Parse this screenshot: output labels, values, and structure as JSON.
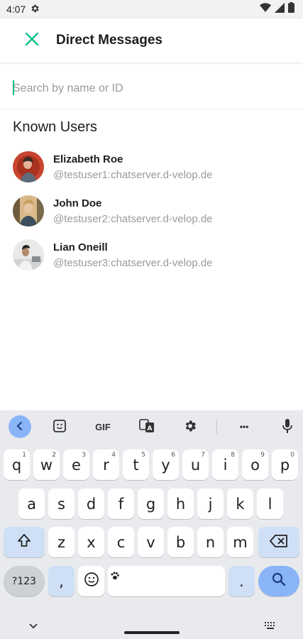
{
  "status_bar": {
    "time": "4:07",
    "icons": [
      "settings-gear-icon",
      "wifi-icon",
      "signal-icon",
      "battery-icon"
    ]
  },
  "app_bar": {
    "title": "Direct Messages",
    "close_icon": "close-icon",
    "accent_color": "#0dbd8b"
  },
  "search": {
    "placeholder": "Search by name or ID",
    "value": ""
  },
  "known_users": {
    "title": "Known Users",
    "users": [
      {
        "name": "Elizabeth Roe",
        "id": "@testuser1:chatserver.d-velop.de"
      },
      {
        "name": "John Doe",
        "id": "@testuser2:chatserver.d-velop.de"
      },
      {
        "name": "Lian Oneill",
        "id": "@testuser3:chatserver.d-velop.de"
      }
    ]
  },
  "keyboard": {
    "toolbar": {
      "back_icon": "chevron-left-icon",
      "sticker_icon": "sticker-icon",
      "gif_label": "GIF",
      "translate_icon": "translate-icon",
      "settings_icon": "gear-icon",
      "more_label": "•••",
      "mic_icon": "microphone-icon"
    },
    "row1": [
      {
        "key": "q",
        "num": "1"
      },
      {
        "key": "w",
        "num": "2"
      },
      {
        "key": "e",
        "num": "3"
      },
      {
        "key": "r",
        "num": "4"
      },
      {
        "key": "t",
        "num": "5"
      },
      {
        "key": "y",
        "num": "6"
      },
      {
        "key": "u",
        "num": "7"
      },
      {
        "key": "i",
        "num": "8"
      },
      {
        "key": "o",
        "num": "9"
      },
      {
        "key": "p",
        "num": "0"
      }
    ],
    "row2": [
      "a",
      "s",
      "d",
      "f",
      "g",
      "h",
      "j",
      "k",
      "l"
    ],
    "row3": [
      "z",
      "x",
      "c",
      "v",
      "b",
      "n",
      "m"
    ],
    "symbols_label": "?123",
    "comma_label": ",",
    "period_label": ".",
    "shift_icon": "shift-icon",
    "backspace_icon": "backspace-icon",
    "emoji_icon": "emoji-icon",
    "search_key_icon": "search-icon",
    "nav_down_icon": "chevron-down-icon",
    "nav_keyboard_icon": "keyboard-icon"
  }
}
